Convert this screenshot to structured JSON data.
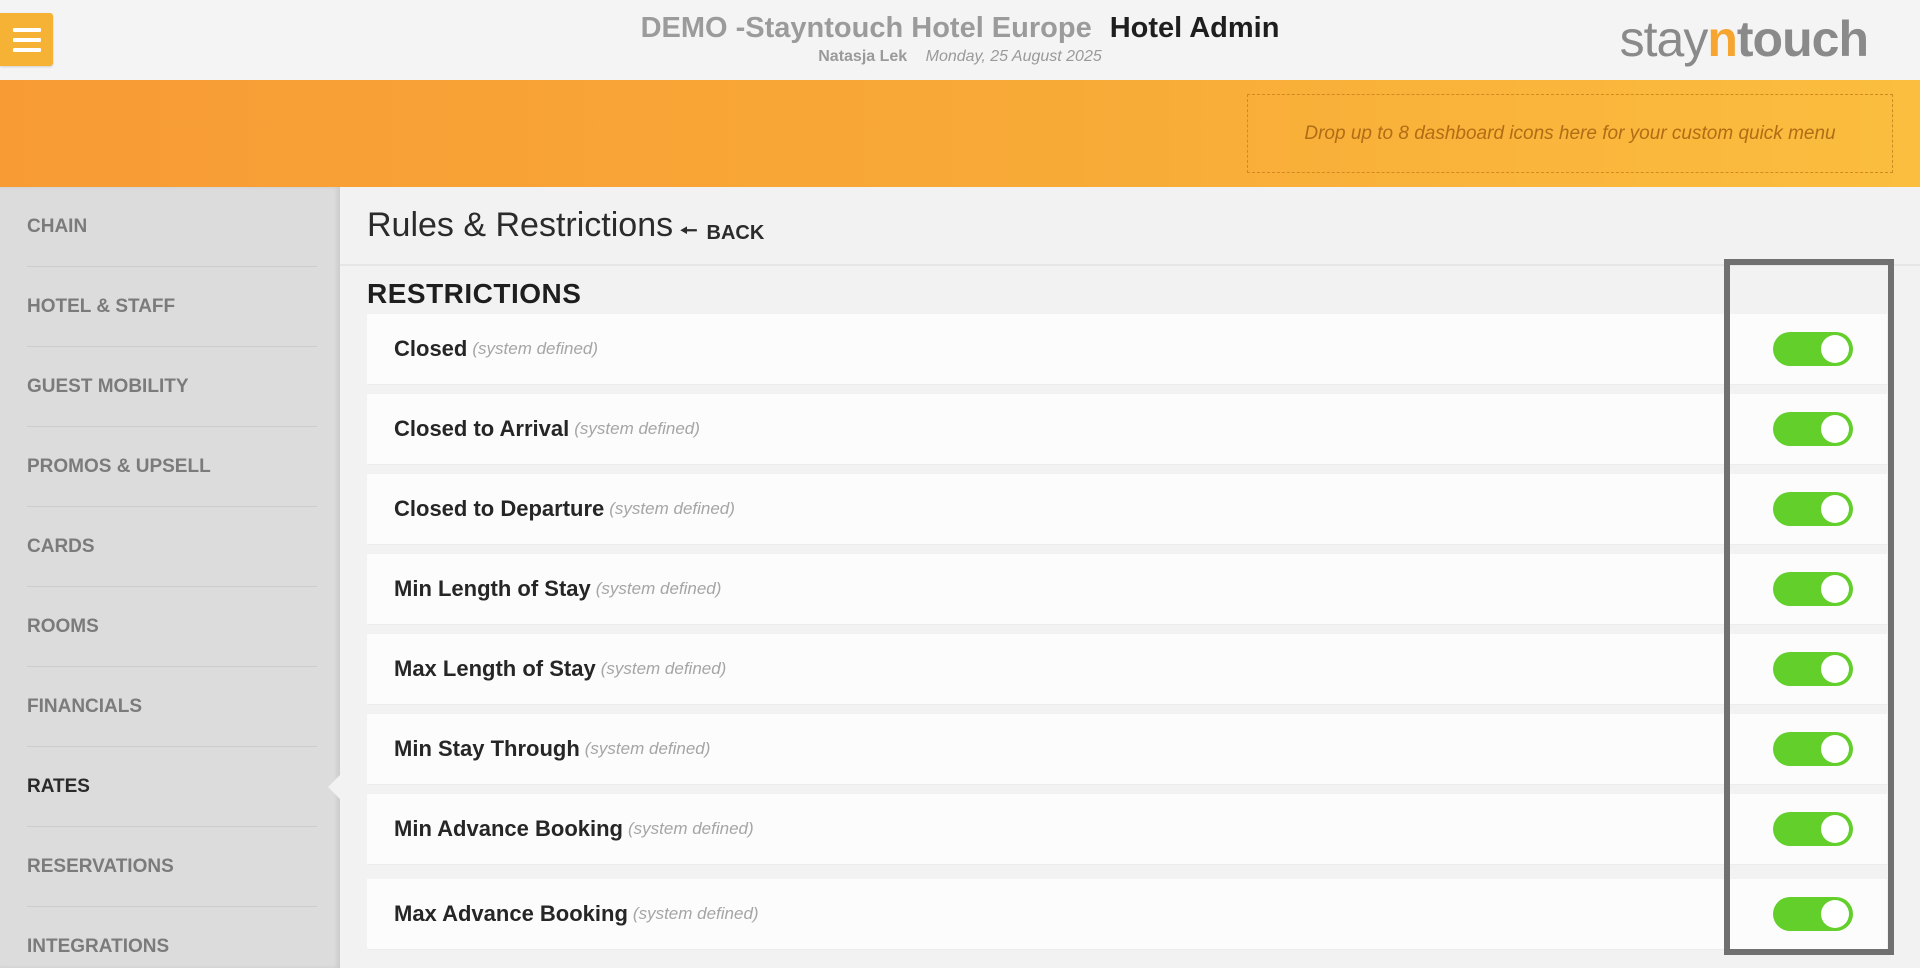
{
  "header": {
    "hotel_name": "DEMO -Stayntouch Hotel Europe",
    "app_name": "Hotel Admin",
    "user": "Natasja Lek",
    "date": "Monday, 25 August 2025",
    "logo": {
      "part1": "stay",
      "part2": "n",
      "part3": "touch"
    },
    "menu_icon": "hamburger-icon"
  },
  "banner": {
    "dropzone_text": "Drop up to 8 dashboard icons here for your custom quick menu"
  },
  "sidebar": {
    "items": [
      {
        "label": "CHAIN"
      },
      {
        "label": "HOTEL & STAFF"
      },
      {
        "label": "GUEST MOBILITY"
      },
      {
        "label": "PROMOS & UPSELL"
      },
      {
        "label": "CARDS"
      },
      {
        "label": "ROOMS"
      },
      {
        "label": "FINANCIALS"
      },
      {
        "label": "RATES",
        "active": true
      },
      {
        "label": "RESERVATIONS"
      },
      {
        "label": "INTEGRATIONS"
      }
    ]
  },
  "main": {
    "title": "Rules & Restrictions",
    "back_label": "BACK",
    "section_title": "RESTRICTIONS",
    "restrictions": [
      {
        "label": "Closed",
        "note": "(system defined)",
        "enabled": true
      },
      {
        "label": "Closed to Arrival",
        "note": "(system defined)",
        "enabled": true
      },
      {
        "label": "Closed to Departure",
        "note": "(system defined)",
        "enabled": true
      },
      {
        "label": "Min Length of Stay",
        "note": "(system defined)",
        "enabled": true
      },
      {
        "label": "Max Length of Stay",
        "note": "(system defined)",
        "enabled": true
      },
      {
        "label": "Min Stay Through",
        "note": "(system defined)",
        "enabled": true
      },
      {
        "label": "Min Advance Booking",
        "note": "(system defined)",
        "enabled": true
      },
      {
        "label": "Max Advance Booking",
        "note": "(system defined)",
        "enabled": true
      }
    ]
  },
  "colors": {
    "accent_orange": "#f8a535",
    "toggle_on": "#62cf2a",
    "menu_button": "#f6b234"
  }
}
